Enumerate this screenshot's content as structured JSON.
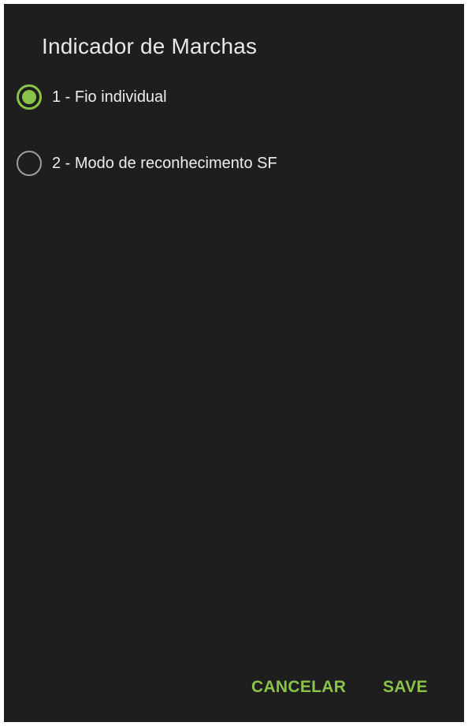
{
  "dialog": {
    "title": "Indicador de Marchas",
    "options": [
      {
        "label": "1 - Fio individual",
        "checked": true
      },
      {
        "label": "2 - Modo de reconhecimento SF",
        "checked": false
      }
    ],
    "buttons": {
      "cancel_label": "CANCELAR",
      "save_label": "SAVE"
    },
    "colors": {
      "background": "#1e1e1e",
      "accent": "#8bc34a",
      "text": "#ededed",
      "radio_unchecked": "#9e9e9e"
    }
  }
}
